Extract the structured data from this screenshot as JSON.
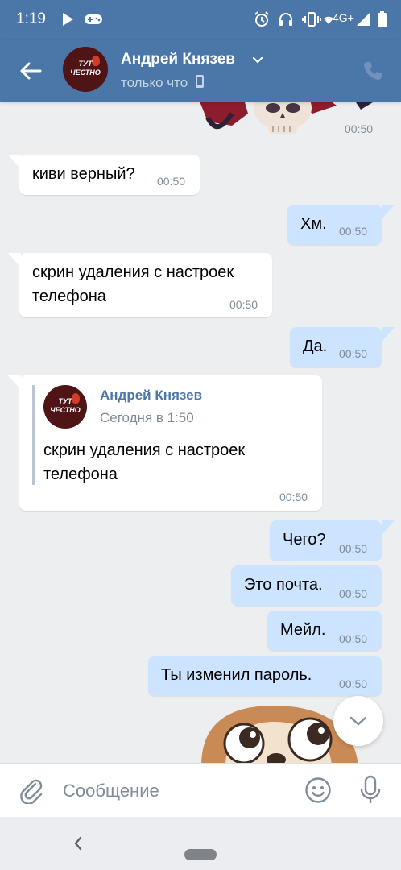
{
  "status_bar": {
    "time": "1:19",
    "network": "4G+",
    "icons": [
      "play-icon",
      "gamepad-icon",
      "alarm-icon",
      "headset-icon",
      "vibrate-icon",
      "wifi-icon",
      "signal-icon",
      "battery-icon"
    ]
  },
  "header": {
    "back_icon": "arrow-left-icon",
    "avatar_text_line1": "ТУТ",
    "avatar_text_line2": "ЧЕСТНО",
    "contact_name": "Андрей Князев",
    "status": "только что",
    "status_icon": "phone-device-icon",
    "call_icon": "phone-icon"
  },
  "messages": [
    {
      "type": "sticker",
      "direction": "out",
      "time": "00:50"
    },
    {
      "direction": "in",
      "text": "киви верный?",
      "time": "00:50"
    },
    {
      "direction": "out",
      "text": "Хм.",
      "time": "00:50"
    },
    {
      "direction": "in",
      "text": "скрин удаления с настроек\nтелефона",
      "time": "00:50"
    },
    {
      "direction": "out",
      "text": "Да.",
      "time": "00:50"
    },
    {
      "direction": "in",
      "type": "forward",
      "forward": {
        "name": "Андрей Князев",
        "date": "Сегодня в 1:50",
        "text": "скрин удаления с настроек\nтелефона"
      },
      "time": "00:50"
    },
    {
      "direction": "out",
      "text": "Чего?",
      "time": "00:50"
    },
    {
      "direction": "out",
      "text": "Это почта.",
      "time": "00:50"
    },
    {
      "direction": "out",
      "text": "Мейл.",
      "time": "00:50"
    },
    {
      "direction": "out",
      "text": "Ты изменил пароль.",
      "time": "00:50"
    },
    {
      "type": "sticker",
      "direction": "in"
    }
  ],
  "composer": {
    "placeholder": "Сообщение",
    "attach_icon": "paperclip-icon",
    "emoji_icon": "smile-icon",
    "mic_icon": "microphone-icon"
  },
  "colors": {
    "accent": "#4a76a8",
    "outgoing_bubble": "#cce4ff",
    "incoming_bubble": "#ffffff",
    "chat_background": "#edeef0",
    "time_text": "#818c99"
  }
}
